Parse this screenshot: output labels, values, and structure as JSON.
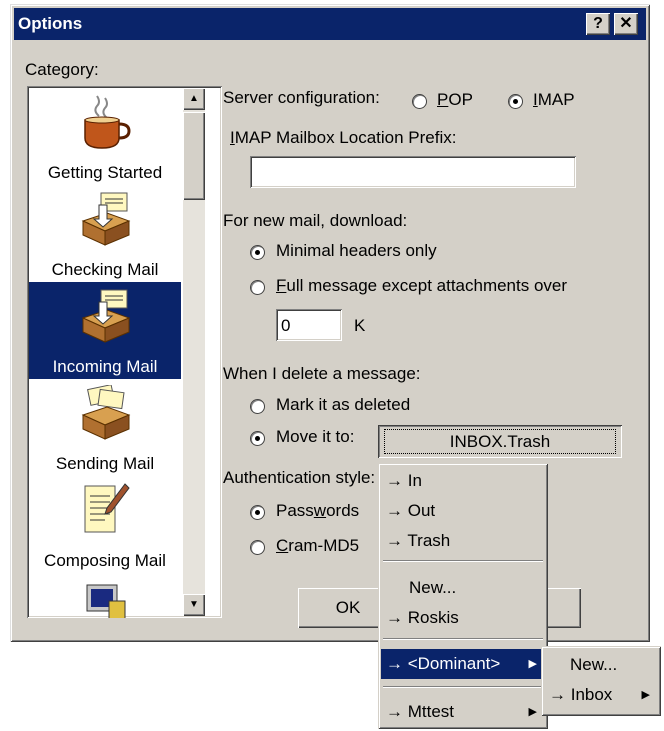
{
  "window": {
    "title": "Options",
    "help_glyph": "?",
    "close_glyph": "✕"
  },
  "category": {
    "label": "Category:",
    "items": [
      {
        "label": "Getting Started",
        "icon": "coffee-cup-icon"
      },
      {
        "label": "Checking Mail",
        "icon": "mailbox-tray-icon"
      },
      {
        "label": "Incoming Mail",
        "icon": "inbox-tray-icon",
        "selected": true
      },
      {
        "label": "Sending Mail",
        "icon": "outbox-tray-icon"
      },
      {
        "label": "Composing Mail",
        "icon": "document-pen-icon"
      },
      {
        "label": "",
        "icon": "computer-icon"
      }
    ],
    "scroll_up": "▲",
    "scroll_down": "▼"
  },
  "server": {
    "label": "Server configuration:",
    "options": [
      {
        "label": "POP",
        "selected": false
      },
      {
        "label": "IMAP",
        "selected": true
      }
    ]
  },
  "prefix": {
    "label": "IMAP Mailbox Location Prefix:",
    "value": ""
  },
  "download": {
    "label": "For new mail, download:",
    "options": [
      {
        "label": "Minimal headers only",
        "selected": true
      },
      {
        "label": "Full message except attachments over",
        "selected": false
      }
    ],
    "size_value": "0",
    "size_unit": "K"
  },
  "delete": {
    "label": "When I delete a message:",
    "options": [
      {
        "label": "Mark it as deleted",
        "selected": false
      },
      {
        "label": "Move it to:",
        "selected": true
      }
    ],
    "folder_button": "INBOX.Trash"
  },
  "auth": {
    "label": "Authentication style:",
    "options": [
      {
        "label": "Passwords",
        "selected": true
      },
      {
        "label": "Cram-MD5",
        "selected": false
      }
    ]
  },
  "buttons": {
    "ok": "OK"
  },
  "folder_menu": {
    "items": [
      {
        "label": "→ In"
      },
      {
        "label": "→ Out"
      },
      {
        "label": "→ Trash"
      },
      {
        "label": "New..."
      },
      {
        "label": "→ Roskis"
      },
      {
        "label": "→ <Dominant>",
        "has_submenu": true,
        "highlighted": true
      },
      {
        "label": "→ Mttest",
        "has_submenu": true
      }
    ],
    "submenu_arrow": "▶"
  },
  "dominant_submenu": {
    "items": [
      {
        "label": "New..."
      },
      {
        "label": "→ Inbox",
        "has_submenu": true
      }
    ]
  },
  "colors": {
    "title_bar": "#0a246a",
    "face": "#d4d0c8",
    "selection": "#0a246a"
  }
}
